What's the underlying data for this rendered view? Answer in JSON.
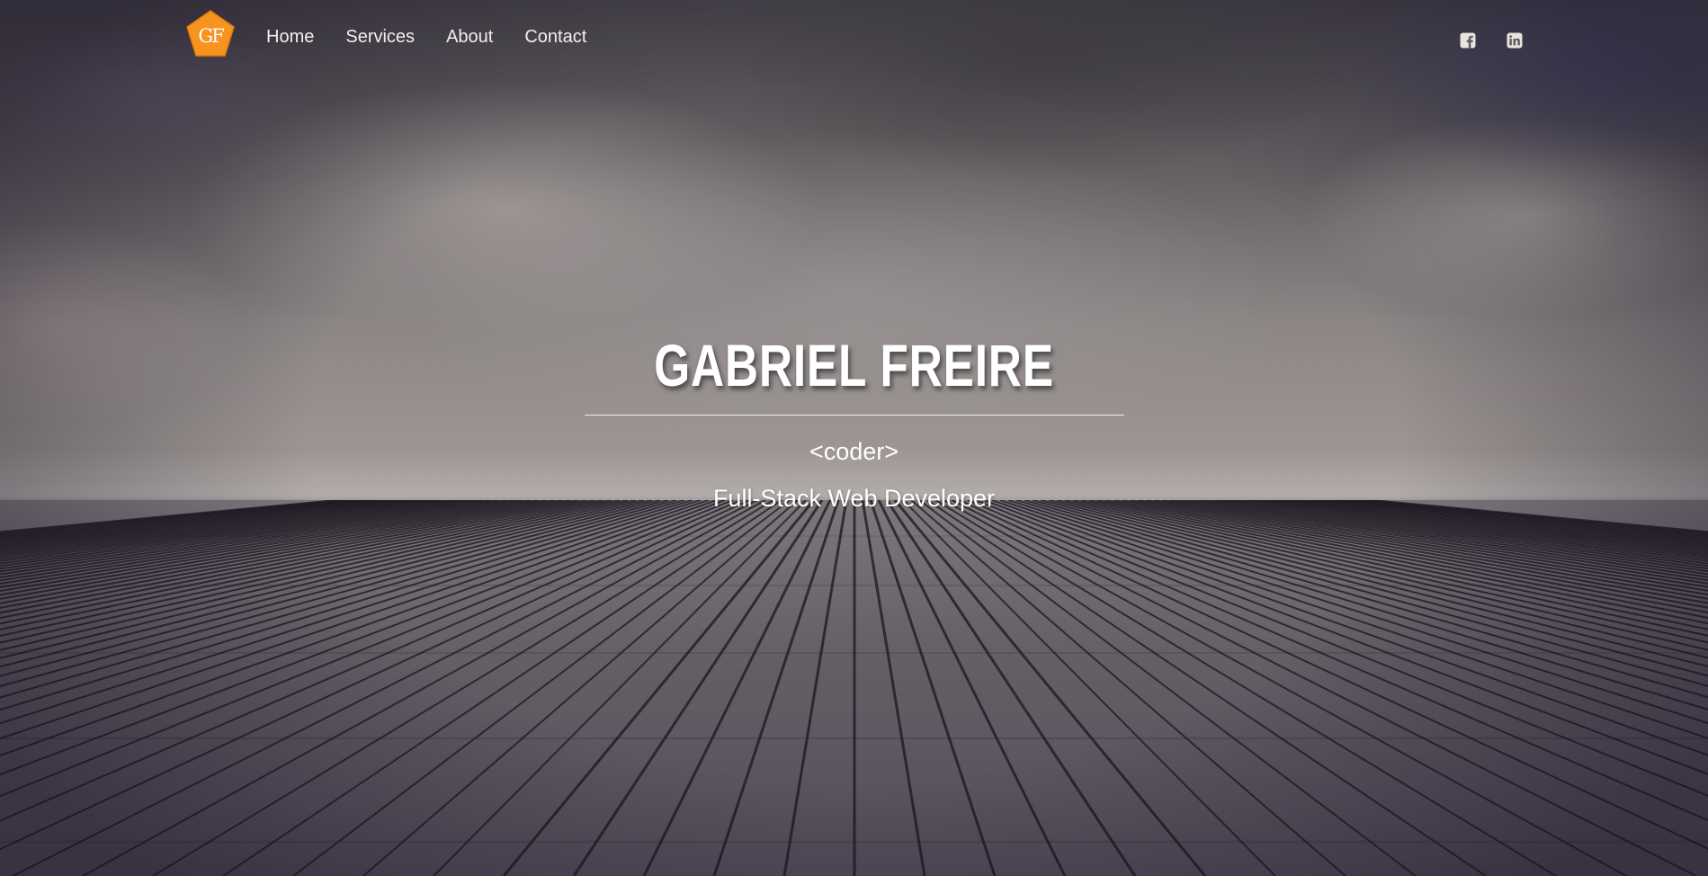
{
  "brand": {
    "logo_text": "GF",
    "accent_color": "#f7931e",
    "icon": "pentagon-logo"
  },
  "nav": {
    "items": [
      {
        "label": "Home"
      },
      {
        "label": "Services"
      },
      {
        "label": "About"
      },
      {
        "label": "Contact"
      }
    ]
  },
  "social": {
    "facebook_icon": "facebook-square-icon",
    "linkedin_icon": "linkedin-square-icon"
  },
  "hero": {
    "name": "GABRIEL FREIRE",
    "tag": "<coder>",
    "subtitle": "Full-Stack Web Developer"
  }
}
